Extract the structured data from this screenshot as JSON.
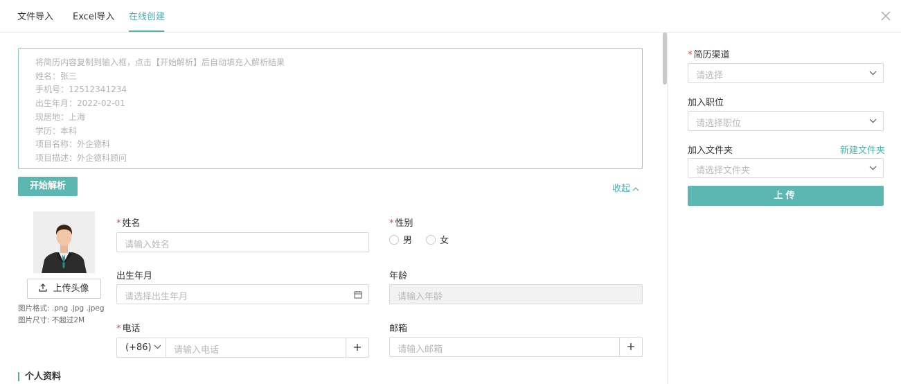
{
  "tabs": [
    {
      "label": "文件导入"
    },
    {
      "label": "Excel导入"
    },
    {
      "label": "在线创建"
    }
  ],
  "paste_area": {
    "placeholder_lines": [
      "将简历内容复制到输入框，点击【开始解析】后自动填充入解析结果",
      "姓名：张三",
      "手机号：12512341234",
      "出生年月：2022-02-01",
      "现居地：上海",
      "学历：本科",
      "项目名称：外企德科",
      "项目描述：外企德科顾问"
    ]
  },
  "actions": {
    "parse_label": "开始解析",
    "collapse_label": "收起"
  },
  "avatar": {
    "upload_label": "上传头像",
    "note": "图片格式: .png .jpg .jpeg 图片尺寸: 不超过2M"
  },
  "form": {
    "name": {
      "label": "姓名",
      "placeholder": "请输入姓名"
    },
    "gender": {
      "label": "性别",
      "options": [
        "男",
        "女"
      ]
    },
    "birth": {
      "label": "出生年月",
      "placeholder": "请选择出生年月"
    },
    "age": {
      "label": "年龄",
      "placeholder": "请输入年龄"
    },
    "phone": {
      "label": "电话",
      "prefix": "(+86)",
      "placeholder": "请输入电话"
    },
    "email": {
      "label": "邮箱",
      "placeholder": "请输入邮箱"
    },
    "required_mark": "*"
  },
  "section": {
    "personal_info": "个人资料"
  },
  "sidebar": {
    "channel": {
      "label": "简历渠道",
      "placeholder": "请选择"
    },
    "position": {
      "label": "加入职位",
      "placeholder": "请选择职位"
    },
    "folder": {
      "label": "加入文件夹",
      "placeholder": "请选择文件夹",
      "new_label": "新建文件夹"
    },
    "upload_label": "上传"
  },
  "colors": {
    "accent": "#5cb7b2",
    "required": "#e24a4a",
    "placeholder": "#b8b8b8"
  }
}
